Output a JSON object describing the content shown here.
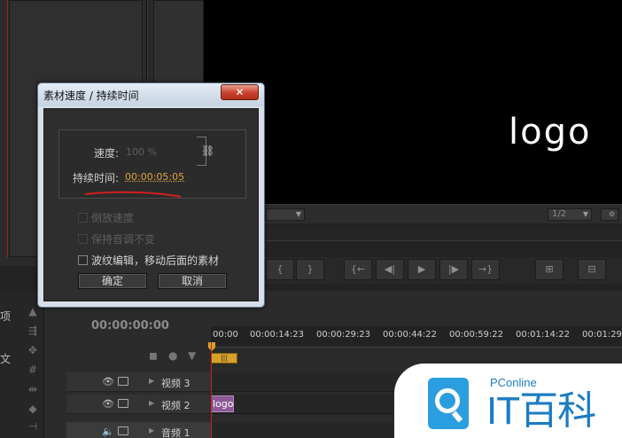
{
  "dialog": {
    "title": "素材速度 / 持续时间",
    "close_label": "✕",
    "speed_label": "速度:",
    "speed_value": "100 %",
    "duration_label": "持续时间:",
    "duration_value": "00:00:05:05",
    "options": [
      {
        "label": "倒放速度",
        "checked": false,
        "enabled": false
      },
      {
        "label": "保持音调不变",
        "checked": false,
        "enabled": false
      },
      {
        "label": "波纹编辑，移动后面的素材",
        "checked": false,
        "enabled": true
      }
    ],
    "ok_label": "确定",
    "cancel_label": "取消",
    "annotation_color": "#d21f1f"
  },
  "program_monitor": {
    "preview_text": "logo",
    "zoom_value": "1/2"
  },
  "left_panel": {
    "label_top": "项",
    "label_bottom": "文"
  },
  "timeline": {
    "timecode": "00:00:00:00",
    "ruler_ticks": [
      "00:00",
      "00:00:14:23",
      "00:00:29:23",
      "00:00:44:22",
      "00:00:59:22",
      "00:01:14:22",
      "00:01:29"
    ],
    "tracks": [
      {
        "name": "视频 3",
        "clip": ""
      },
      {
        "name": "视频 2",
        "clip": "logo"
      },
      {
        "name": "音频 1",
        "clip": ""
      }
    ],
    "clip_color": "#8b5a96",
    "playhead_color": "#cf2020"
  },
  "watermark": {
    "brand": "PConline",
    "title": "IT百科",
    "color": "#1b7cc4"
  }
}
